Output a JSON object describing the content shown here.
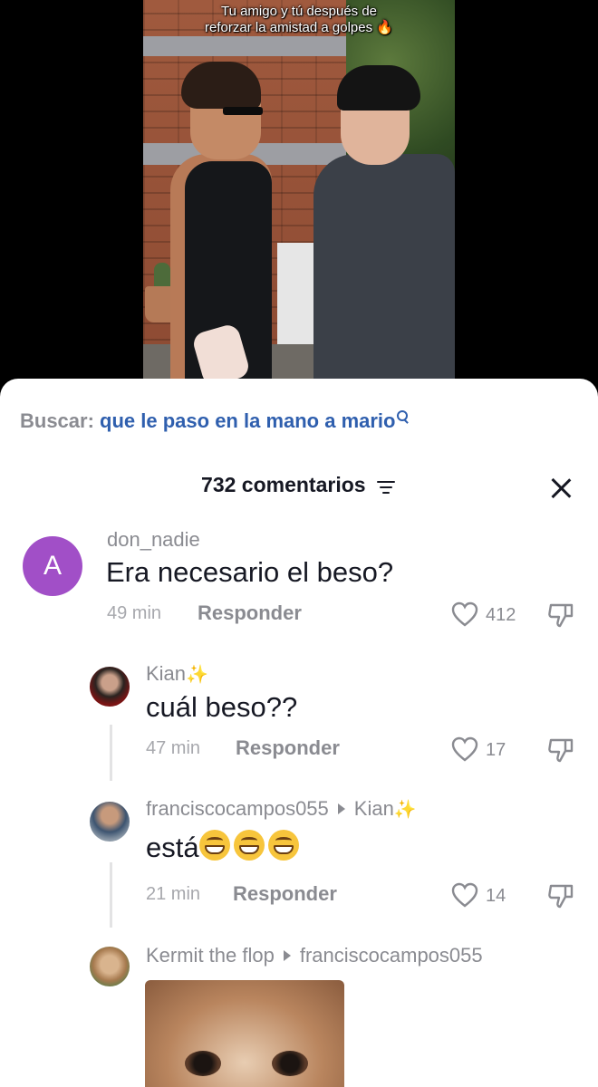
{
  "video": {
    "caption_line1": "Tu amigo y tú después de",
    "caption_line2": "reforzar la amistad a golpes 🔥"
  },
  "search": {
    "label": "Buscar:",
    "query": "que le paso en la mano a mario"
  },
  "header": {
    "title": "732 comentarios"
  },
  "comments": [
    {
      "avatar_letter": "A",
      "username": "don_nadie",
      "text": "Era necesario el beso?",
      "time": "49 min",
      "reply_label": "Responder",
      "likes": "412"
    },
    {
      "username": "Kian",
      "sparkle": "✨",
      "text": "cuál beso??",
      "time": "47 min",
      "reply_label": "Responder",
      "likes": "17"
    },
    {
      "username": "franciscocampos055",
      "reply_to": "Kian",
      "sparkle": "✨",
      "text": "está",
      "time": "21 min",
      "reply_label": "Responder",
      "likes": "14"
    },
    {
      "username": "Kermit the flop",
      "reply_to": "franciscocampos055"
    }
  ],
  "colors": {
    "accent_link": "#2f5fae",
    "avatar_a": "#a14fc7",
    "muted_text": "#8a8b91"
  }
}
